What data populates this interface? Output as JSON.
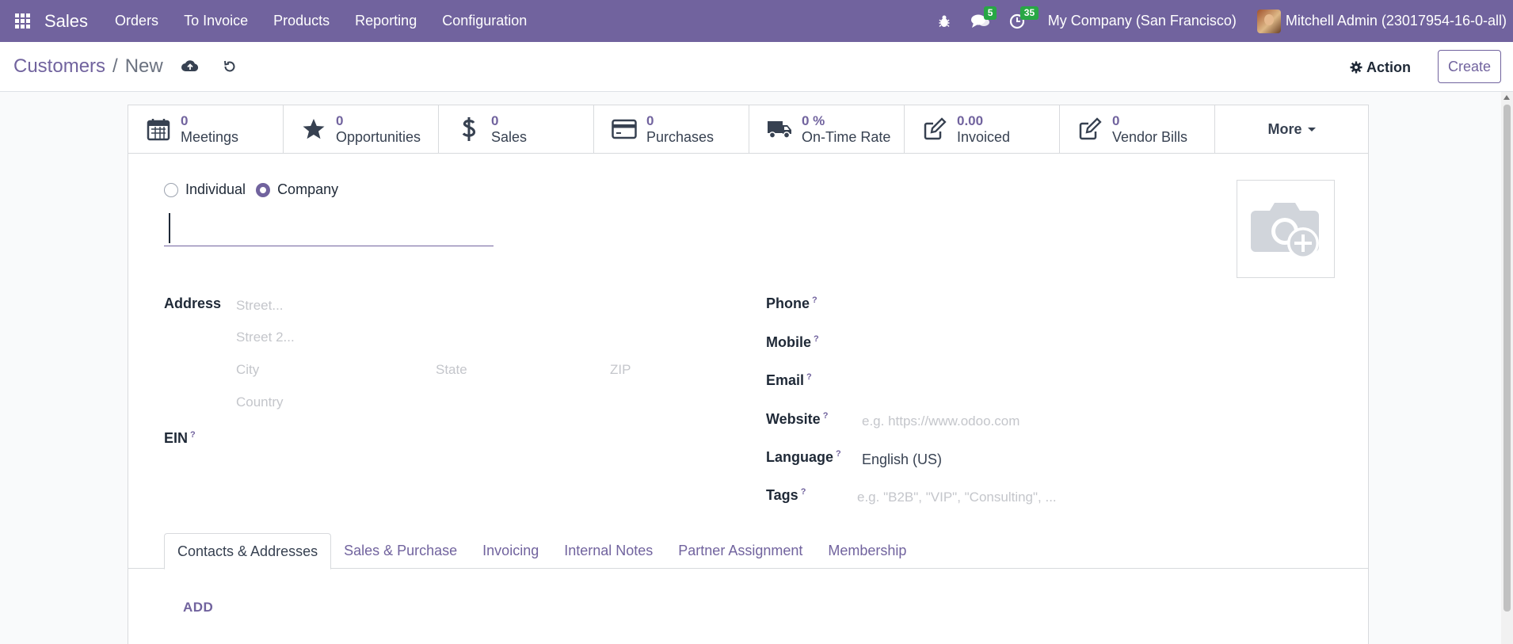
{
  "navbar": {
    "app_name": "Sales",
    "menu": [
      "Orders",
      "To Invoice",
      "Products",
      "Reporting",
      "Configuration"
    ],
    "messages_count": "5",
    "activities_count": "35",
    "company": "My Company (San Francisco)",
    "user": "Mitchell Admin (23017954-16-0-all)",
    "bg_color": "#71639e"
  },
  "control_panel": {
    "breadcrumb_parent": "Customers",
    "breadcrumb_sep": "/",
    "breadcrumb_current": "New",
    "action_label": "Action",
    "create_label": "Create"
  },
  "stat_buttons": [
    {
      "value": "0",
      "label": "Meetings",
      "icon": "calendar-icon"
    },
    {
      "value": "0",
      "label": "Opportunities",
      "icon": "star-icon"
    },
    {
      "value": "0",
      "label": "Sales",
      "icon": "dollar-icon"
    },
    {
      "value": "0",
      "label": "Purchases",
      "icon": "credit-card-icon"
    },
    {
      "value": "0 %",
      "label": "On-Time Rate",
      "icon": "truck-icon"
    },
    {
      "value": "0.00",
      "label": "Invoiced",
      "icon": "pencil-square-icon"
    },
    {
      "value": "0",
      "label": "Vendor Bills",
      "icon": "pencil-square-icon"
    }
  ],
  "more_label": "More",
  "company_type": {
    "individual": "Individual",
    "company": "Company",
    "selected": "company"
  },
  "address": {
    "label": "Address",
    "street_ph": "Street...",
    "street2_ph": "Street 2...",
    "city_ph": "City",
    "state_ph": "State",
    "zip_ph": "ZIP",
    "country_ph": "Country"
  },
  "ein_label": "EIN",
  "help_mark": "?",
  "contact": {
    "phone_label": "Phone",
    "mobile_label": "Mobile",
    "email_label": "Email",
    "website_label": "Website",
    "website_ph": "e.g. https://www.odoo.com",
    "language_label": "Language",
    "language_value": "English (US)",
    "tags_label": "Tags",
    "tags_ph": "e.g. \"B2B\", \"VIP\", \"Consulting\", ..."
  },
  "tabs": [
    "Contacts & Addresses",
    "Sales & Purchase",
    "Invoicing",
    "Internal Notes",
    "Partner Assignment",
    "Membership"
  ],
  "add_label": "ADD"
}
